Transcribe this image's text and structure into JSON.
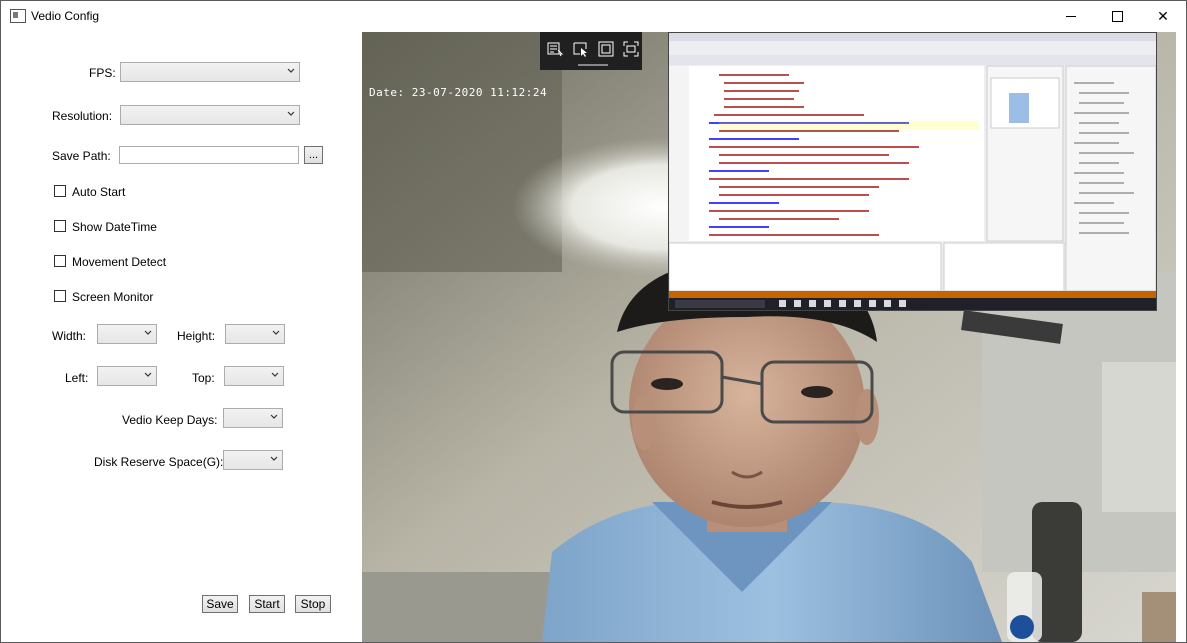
{
  "window": {
    "title": "Vedio Config",
    "icon": "app-window-icon",
    "controls": [
      "minimize-icon",
      "maximize-icon",
      "close-icon"
    ],
    "close_glyph": "✕"
  },
  "form": {
    "fps_label": "FPS:",
    "fps_value": "",
    "resolution_label": "Resolution:",
    "resolution_value": "",
    "save_path_label": "Save Path:",
    "save_path_value": "",
    "browse_label": "...",
    "auto_start_label": "Auto Start",
    "auto_start_checked": false,
    "show_datetime_label": "Show DateTime",
    "show_datetime_checked": false,
    "movement_detect_label": "Movement Detect",
    "movement_detect_checked": false,
    "screen_monitor_label": "Screen Monitor",
    "screen_monitor_checked": false,
    "width_label": "Width:",
    "width_value": "",
    "height_label": "Height:",
    "height_value": "",
    "left_label": "Left:",
    "left_value": "",
    "top_label": "Top:",
    "top_value": "",
    "keep_days_label": "Vedio Keep Days:",
    "keep_days_value": "",
    "disk_reserve_label": "Disk Reserve Space(G):",
    "disk_reserve_value": ""
  },
  "actions": {
    "save_label": "Save",
    "start_label": "Start",
    "stop_label": "Stop"
  },
  "preview": {
    "timestamp": "Date: 23-07-2020 11:12:24",
    "toolbar_icons": [
      "select-window-icon",
      "select-region-icon",
      "fullscreen-icon",
      "capture-area-icon"
    ]
  }
}
